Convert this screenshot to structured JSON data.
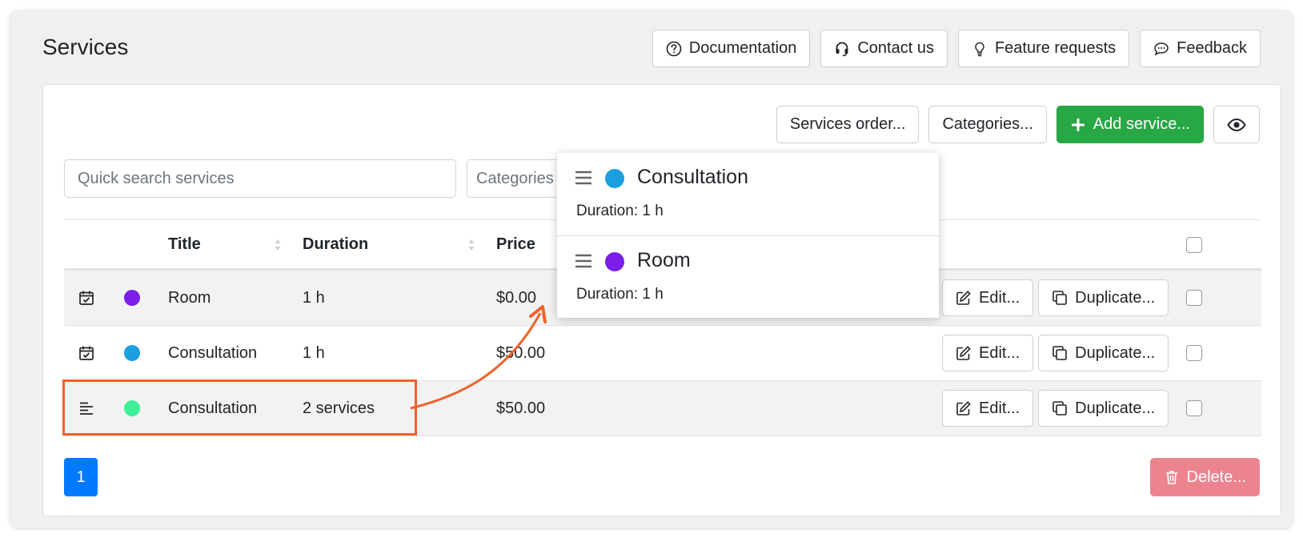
{
  "header": {
    "title": "Services"
  },
  "top_buttons": [
    {
      "label": "Documentation",
      "icon": "question-circle-icon"
    },
    {
      "label": "Contact us",
      "icon": "headset-icon"
    },
    {
      "label": "Feature requests",
      "icon": "lightbulb-icon"
    },
    {
      "label": "Feedback",
      "icon": "chat-bubble-icon"
    }
  ],
  "toolbar": {
    "services_order": "Services order...",
    "categories": "Categories...",
    "add_service": "Add service...",
    "visibility_icon": "eye-icon"
  },
  "filters": {
    "search_placeholder": "Quick search services",
    "categories_placeholder": "Categories"
  },
  "table": {
    "columns": [
      "Title",
      "Duration",
      "Price"
    ],
    "rows": [
      {
        "type_icon": "calendar-check-icon",
        "color": "#7a1ee8",
        "title": "Room",
        "duration": "1 h",
        "price": "$0.00"
      },
      {
        "type_icon": "calendar-check-icon",
        "color": "#1b9fe0",
        "title": "Consultation",
        "duration": "1 h",
        "price": "$50.00"
      },
      {
        "type_icon": "align-left-icon",
        "color": "#3ef09a",
        "title": "Consultation",
        "duration": "2 services",
        "price": "$50.00"
      }
    ],
    "edit_label": "Edit...",
    "duplicate_label": "Duplicate..."
  },
  "popup": {
    "items": [
      {
        "color": "#1b9fe0",
        "title": "Consultation",
        "duration": "Duration: 1 h"
      },
      {
        "color": "#7a1ee8",
        "title": "Room",
        "duration": "Duration: 1 h"
      }
    ]
  },
  "pagination": {
    "current": "1"
  },
  "footer": {
    "delete_label": "Delete..."
  },
  "colors": {
    "primary": "#007bff",
    "success": "#28a745",
    "danger_disabled": "#ec8490",
    "highlight": "#f0622a"
  }
}
